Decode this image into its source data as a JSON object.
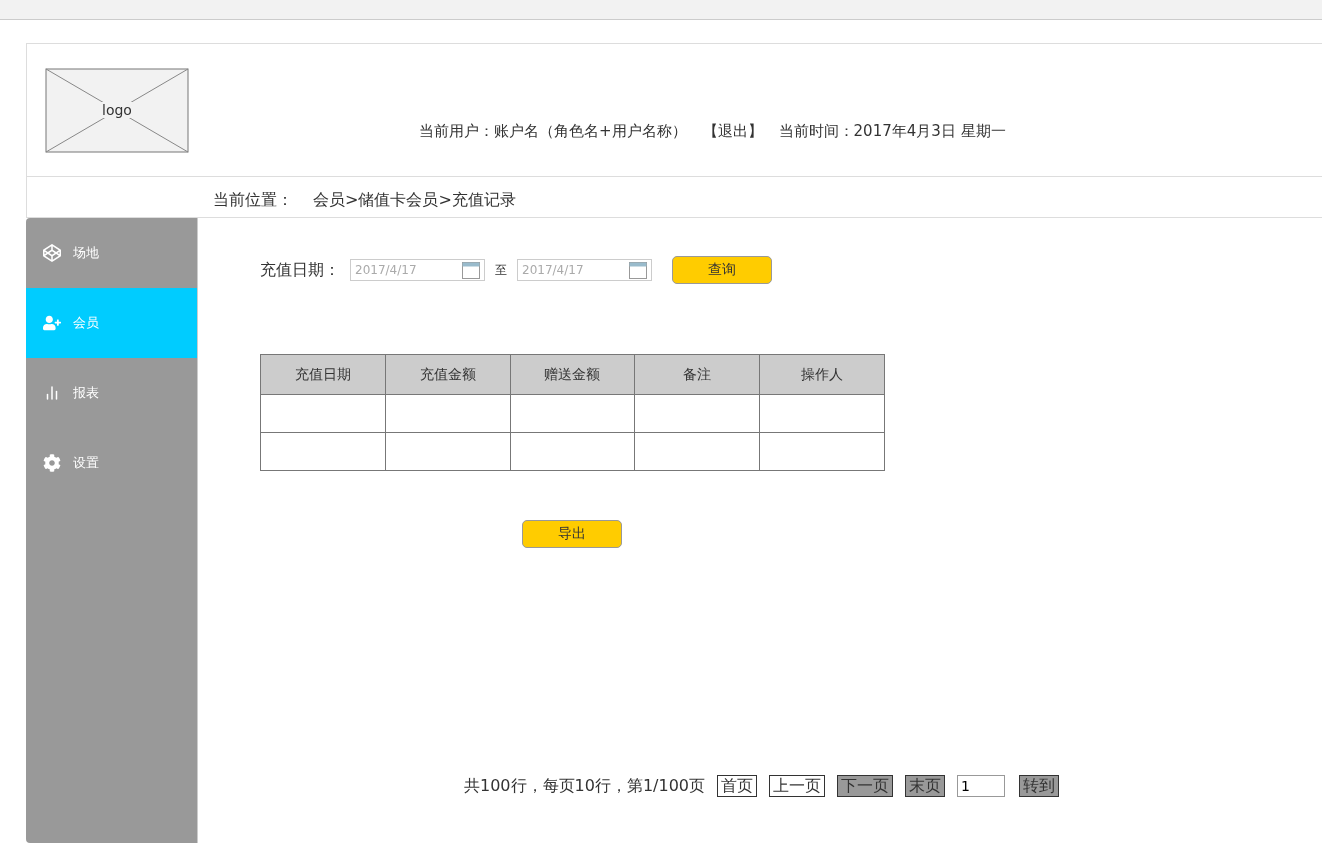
{
  "header": {
    "logo": "logo",
    "user_label": "当前用户：账户名（角色名+用户名称）",
    "logout": "【退出】",
    "time_label": "当前时间：2017年4月3日   星期一"
  },
  "breadcrumb": {
    "label": "当前位置：",
    "path": "会员>储值卡会员>充值记录"
  },
  "sidebar": {
    "items": [
      {
        "kind": "venue",
        "label": "场地",
        "selected": false
      },
      {
        "kind": "member",
        "label": "会员",
        "selected": true
      },
      {
        "kind": "report",
        "label": "报表",
        "selected": false
      },
      {
        "kind": "settings",
        "label": "设置",
        "selected": false
      }
    ]
  },
  "filter": {
    "label": "充值日期：",
    "start": "2017/4/17",
    "separator": "至",
    "end": "2017/4/17",
    "button": "查询"
  },
  "table": {
    "columns": [
      "充值日期",
      "充值金额",
      "赠送金额",
      "备注",
      "操作人"
    ]
  },
  "export_button": "导出",
  "pagination": {
    "summary": "共100行，每页10行，第1/100页",
    "buttons": [
      {
        "label": "首页",
        "shaded": false
      },
      {
        "label": "上一页",
        "shaded": false
      },
      {
        "label": "下一页",
        "shaded": true
      },
      {
        "label": "末页",
        "shaded": true
      }
    ],
    "page_input": "1",
    "go": {
      "label": "转到",
      "shaded": true
    }
  }
}
